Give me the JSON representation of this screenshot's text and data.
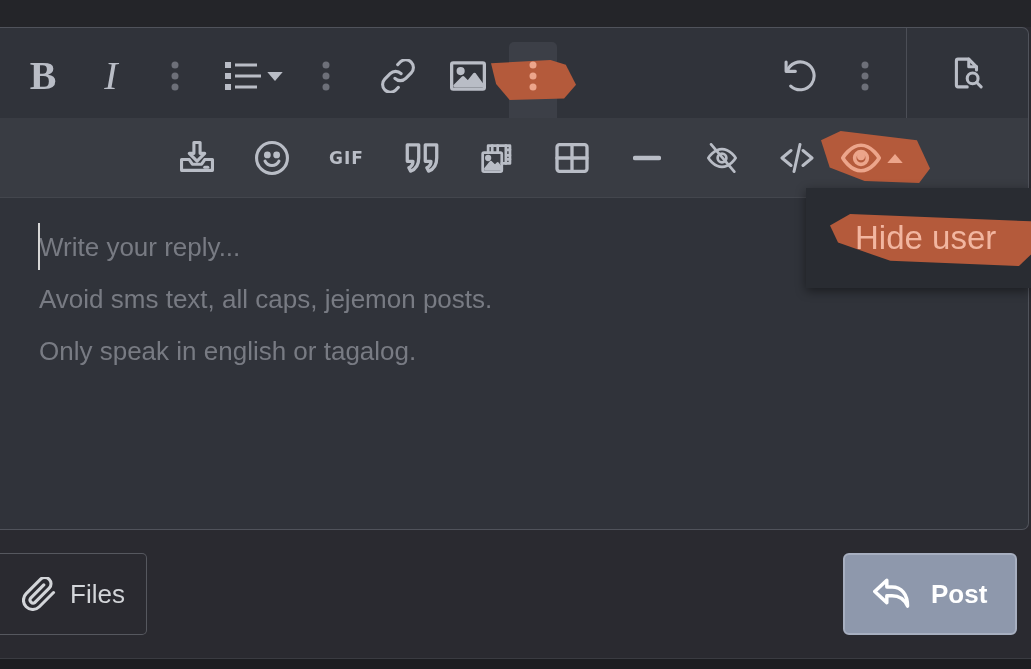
{
  "toolbar": {
    "main_left": [
      {
        "kind": "letter",
        "label": "B",
        "highlighted": false
      },
      {
        "kind": "letter",
        "label": "I",
        "highlighted": false
      },
      {
        "kind": "more",
        "expanded": false,
        "highlighted": false
      },
      {
        "kind": "dropdown",
        "expanded": false,
        "highlighted": false
      },
      {
        "kind": "more",
        "expanded": false,
        "highlighted": false
      },
      {
        "kind": "button",
        "highlighted": false
      },
      {
        "kind": "button",
        "highlighted": false
      },
      {
        "kind": "more",
        "expanded": true,
        "highlighted": true
      }
    ],
    "main_right": [
      {
        "kind": "button",
        "highlighted": false
      },
      {
        "kind": "more",
        "expanded": false,
        "highlighted": false
      }
    ],
    "more_row": [
      {
        "kind": "button",
        "highlighted": false
      },
      {
        "kind": "button",
        "highlighted": false
      },
      {
        "kind": "letter",
        "label": "GIF",
        "highlighted": false
      },
      {
        "kind": "button",
        "highlighted": false
      },
      {
        "kind": "button",
        "highlighted": false
      },
      {
        "kind": "button",
        "highlighted": false
      },
      {
        "kind": "button",
        "highlighted": false
      },
      {
        "kind": "button",
        "highlighted": false
      },
      {
        "kind": "button",
        "highlighted": false
      },
      {
        "kind": "dropdown",
        "expanded": true,
        "highlighted": true,
        "menu": [
          {
            "label": "Hide user",
            "highlighted": true
          }
        ]
      }
    ]
  },
  "editor": {
    "placeholder": "Write your reply...\nAvoid sms text, all caps, jejemon posts.\nOnly speak in english or tagalog.",
    "focused": true
  },
  "buttons": [
    {
      "kind": "secondary",
      "label": "Files"
    },
    {
      "kind": "primary",
      "label": "Post"
    }
  ]
}
